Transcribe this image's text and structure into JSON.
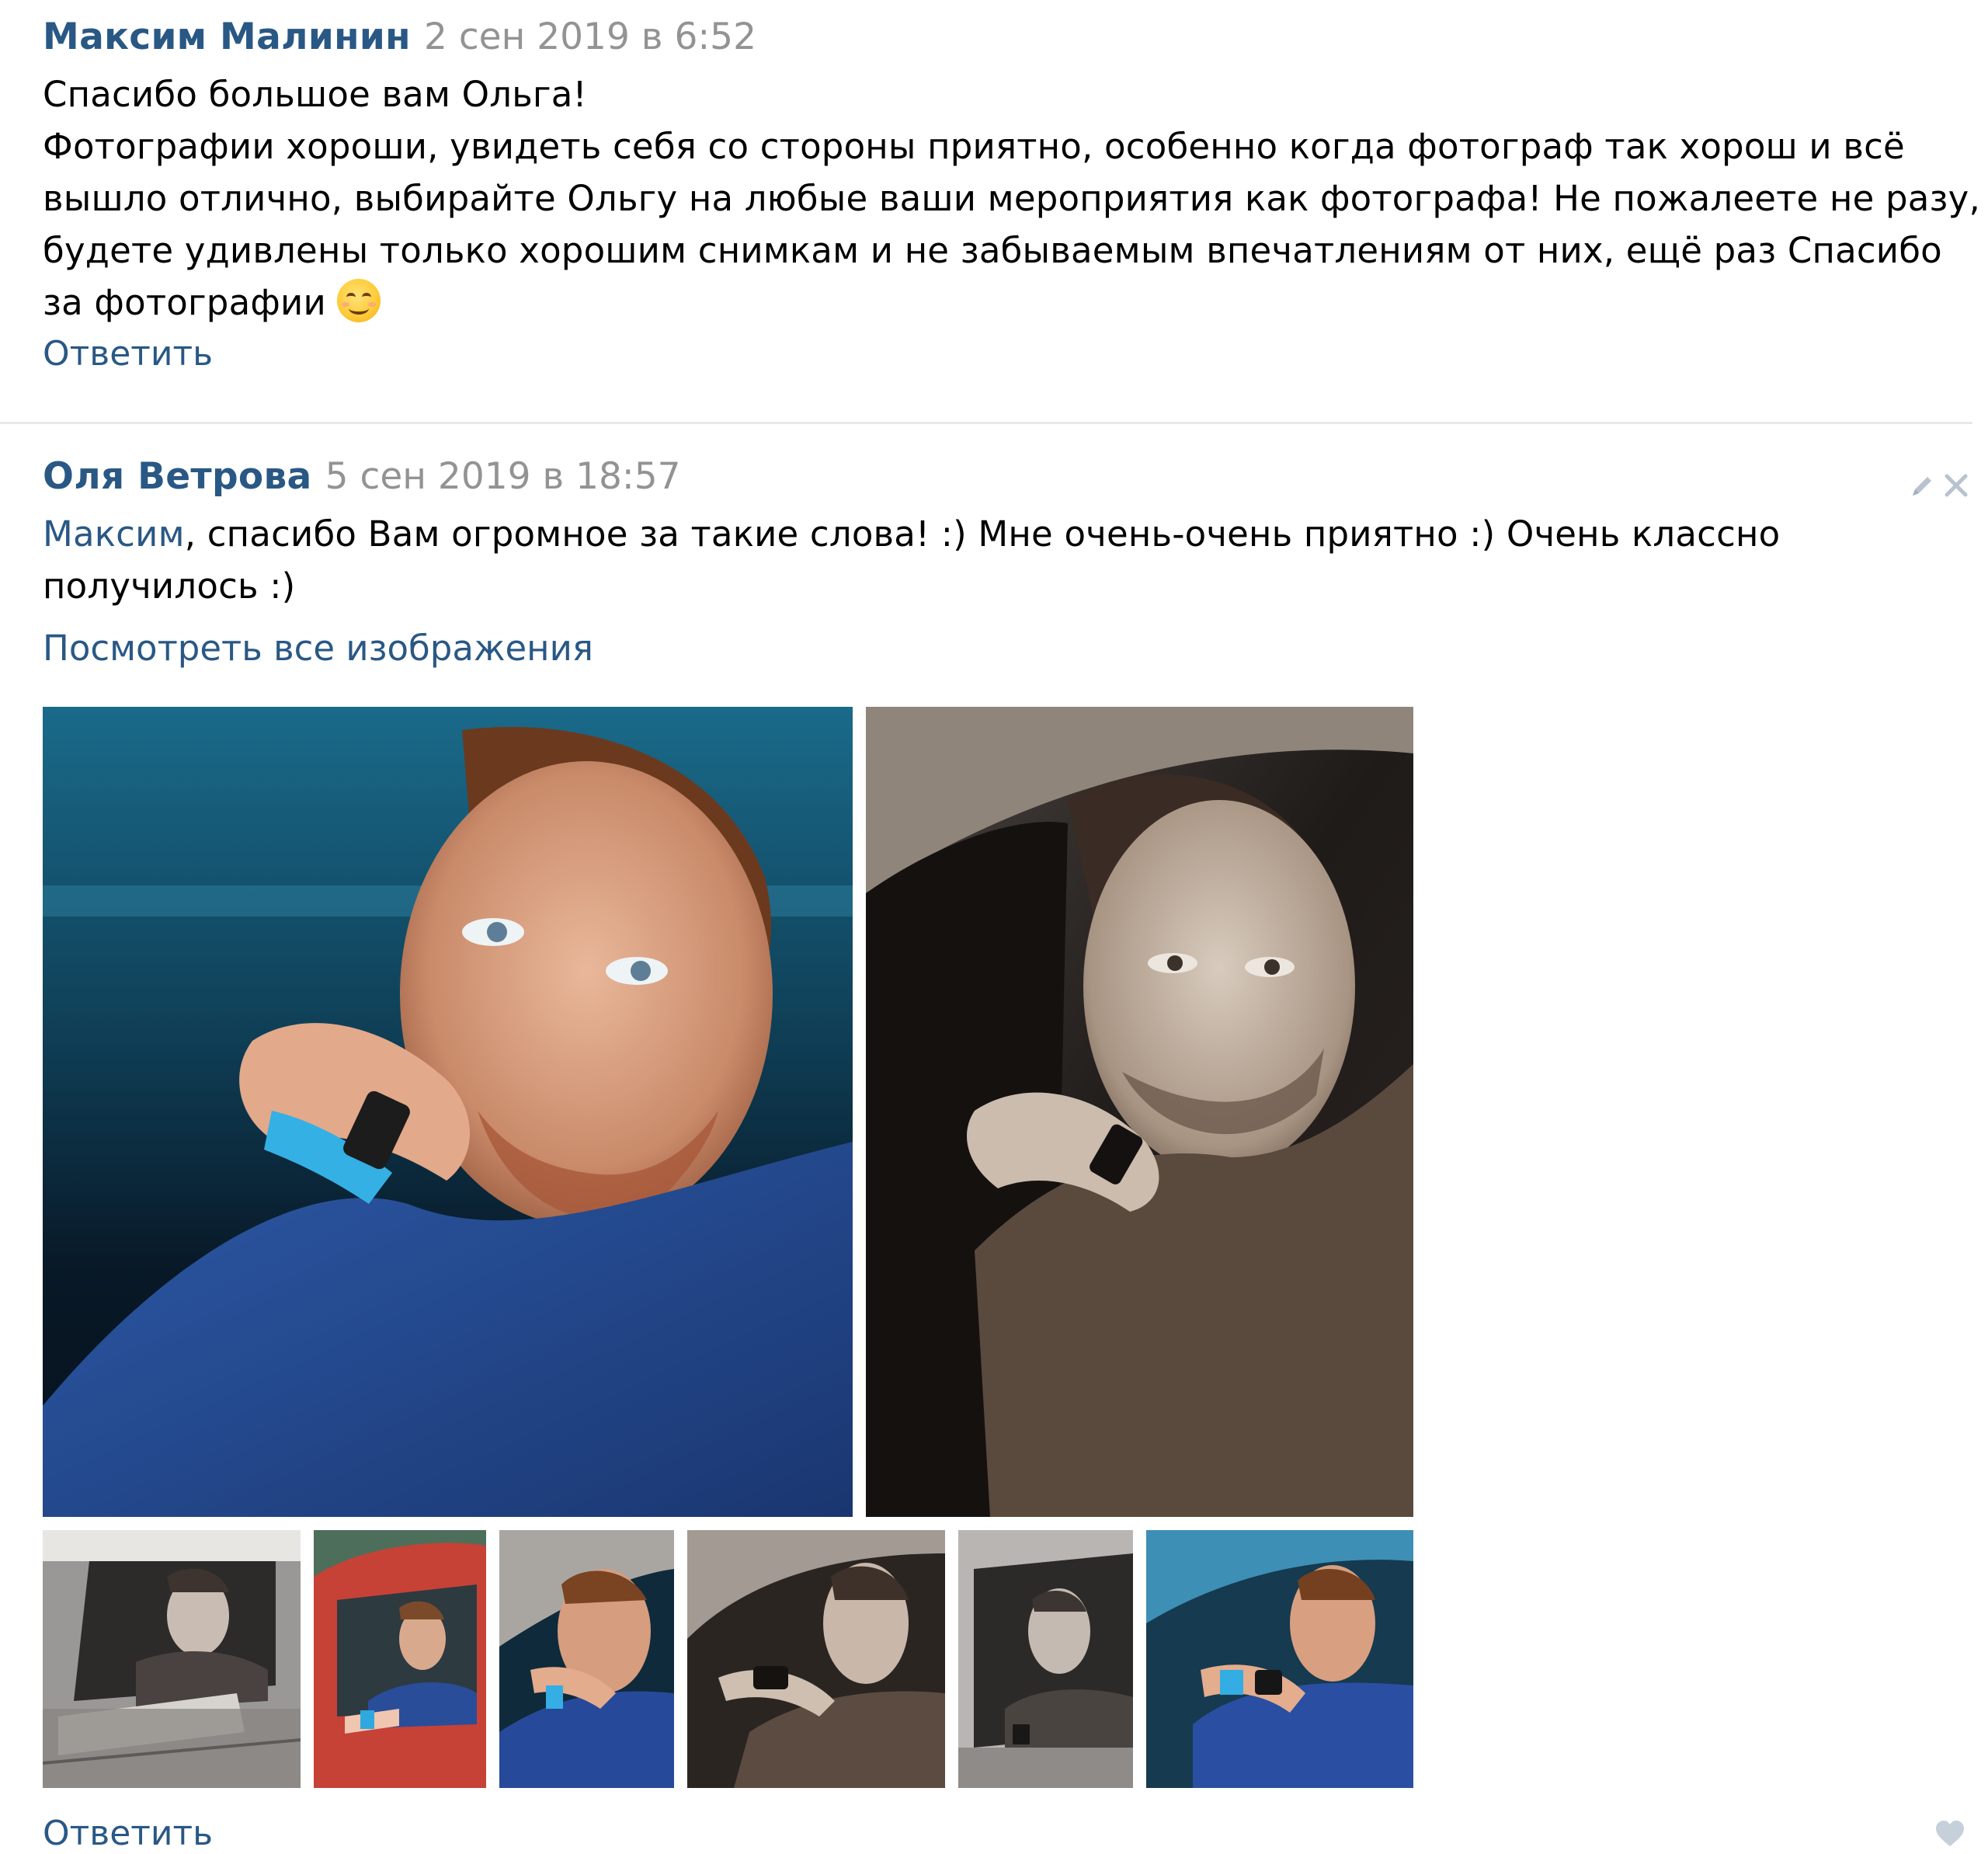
{
  "comments": [
    {
      "author": "Максим Малинин",
      "date": "2 сен 2019 в 6:52",
      "lines": [
        "Спасибо большое вам Ольга!",
        "Фотографии хороши, увидеть себя со стороны приятно, особенно когда фотограф так хорош и всё",
        "вышло отлично, выбирайте Ольгу на любые ваши мероприятия как фотографа! Не пожалеете не разу,",
        "будете удивлены только хорошим снимкам и не забываемым впечатлениям от них, ещё раз Спасибо",
        "за фотографии"
      ],
      "emoji": "smiling-face-with-smiling-eyes",
      "reply_label": "Ответить"
    },
    {
      "author": "Оля Ветрова",
      "date": "5 сен 2019 в 18:57",
      "mention": "Максим",
      "line1_rest": ", спасибо Вам огромное за такие слова! :) Мне очень-очень приятно :) Очень классно",
      "line2": "получилось :)",
      "view_all_label": "Посмотреть все изображения",
      "reply_label": "Ответить",
      "icons": [
        "pencil-icon",
        "close-icon",
        "heart-icon"
      ],
      "photos": {
        "large": [
          {
            "name": "photo-blue-shirt-portrait",
            "tone": "color"
          },
          {
            "name": "photo-sepia-portrait",
            "tone": "sepia"
          }
        ],
        "thumbnails": [
          {
            "name": "thumb-grey-car-window",
            "tone": "grey"
          },
          {
            "name": "thumb-red-car",
            "tone": "color"
          },
          {
            "name": "thumb-blue-closeup",
            "tone": "color"
          },
          {
            "name": "thumb-sepia-closeup",
            "tone": "sepia"
          },
          {
            "name": "thumb-grey-car-bw",
            "tone": "grey"
          },
          {
            "name": "thumb-blue-side",
            "tone": "color"
          }
        ]
      }
    }
  ],
  "colors": {
    "link": "#2a5885",
    "date": "#939393",
    "icon": "#b8c3cf",
    "divider": "#e7e8ec"
  }
}
